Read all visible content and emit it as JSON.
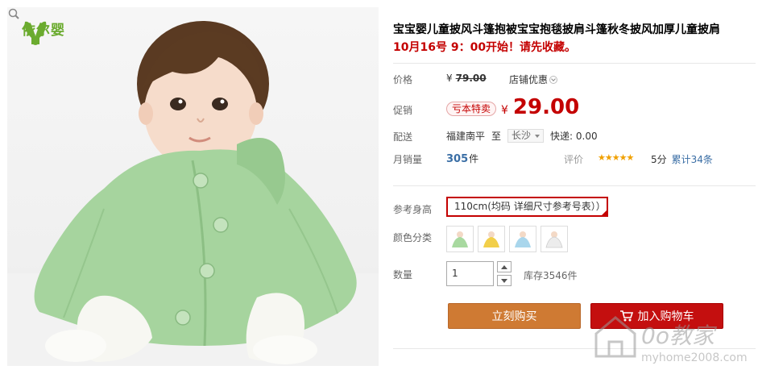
{
  "brand": {
    "name": "依尔婴"
  },
  "product": {
    "title": "宝宝婴儿童披风斗篷抱被宝宝抱毯披肩斗篷秋冬披风加厚儿童披肩",
    "notice": "10月16号 9：00开始！请先收藏。"
  },
  "price": {
    "label": "价格",
    "currency": "¥",
    "original": "79.00",
    "shop_promo": "店铺优惠"
  },
  "promo": {
    "label": "促销",
    "tag": "亏本特卖",
    "currency": "¥",
    "price": "29.00"
  },
  "shipping": {
    "label": "配送",
    "from": "福建南平",
    "to_word": "至",
    "dest": "长沙",
    "express": "快递: 0.00"
  },
  "sales": {
    "label": "月销量",
    "count": "305",
    "unit": "件",
    "rating_label": "评价",
    "stars": "★★★★★",
    "score": "5分",
    "reviews": "累计34条"
  },
  "options": {
    "size_label": "参考身高",
    "size_value": "110cm(均码 详细尺寸参考号表））",
    "color_label": "颜色分类",
    "colors": [
      "#a8d9a0",
      "#f2cf4a",
      "#a9d6ec",
      "#ececec"
    ]
  },
  "quantity": {
    "label": "数量",
    "value": "1",
    "stock": "库存3546件"
  },
  "actions": {
    "buy_now": "立刻购买",
    "add_to_cart": "加入购物车"
  },
  "watermark": {
    "text": "0o教家",
    "url": "myhome2008.com"
  }
}
